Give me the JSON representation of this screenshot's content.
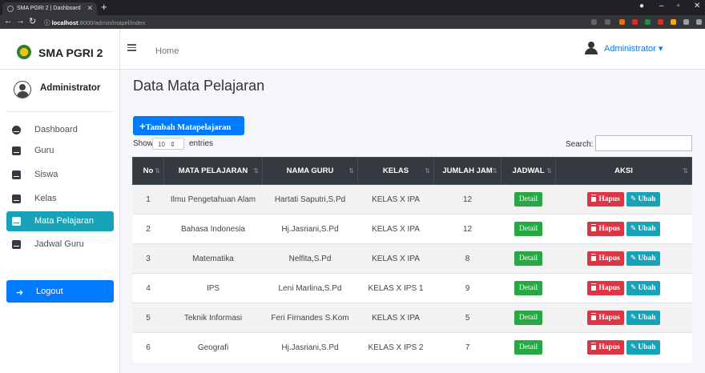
{
  "browser": {
    "tab_title": "SMA PGRI 2 | Dashboard",
    "url_host": "localhost",
    "url_rest": ":8000/admin/mapel/index"
  },
  "sidebar": {
    "brand": "SMA PGRI 2",
    "user": "Administrator",
    "items": [
      {
        "label": "Dashboard",
        "icon": "tachometer-icon"
      },
      {
        "label": "Guru",
        "icon": "table-icon"
      },
      {
        "label": "Siswa",
        "icon": "table-icon"
      },
      {
        "label": "Kelas",
        "icon": "table-icon"
      },
      {
        "label": "Mata Pelajaran",
        "icon": "table-icon",
        "active": true
      },
      {
        "label": "Jadwal Guru",
        "icon": "table-icon"
      }
    ],
    "logout": "Logout"
  },
  "header": {
    "home": "Home",
    "user": "Administrator"
  },
  "main": {
    "title": "Data Mata Pelajaran",
    "add_button": "Tambah Matapelajaran",
    "show_label": "Show",
    "show_value": "10",
    "entries_label": "entries",
    "search_label": "Search:"
  },
  "table": {
    "headers": [
      "No",
      "MATA PELAJARAN",
      "NAMA GURU",
      "KELAS",
      "JUMLAH JAM",
      "JADWAL",
      "AKSI"
    ],
    "detail_label": "Detail",
    "hapus_label": "Hapus",
    "ubah_label": "Ubah",
    "rows": [
      [
        "1",
        "Ilmu Pengetahuan Alam",
        "Hartati Saputri,S.Pd",
        "KELAS X IPA",
        "12"
      ],
      [
        "2",
        "Bahasa Indonesia",
        "Hj.Jasriani,S.Pd",
        "KELAS X IPA",
        "12"
      ],
      [
        "3",
        "Matematika",
        "Nelfita,S.Pd",
        "KELAS X IPA",
        "8"
      ],
      [
        "4",
        "IPS",
        "Leni Marlina,S.Pd",
        "KELAS X IPS 1",
        "9"
      ],
      [
        "5",
        "Teknik Informasi",
        "Feri Firnandes S.Kom",
        "KELAS X IPA",
        "5"
      ],
      [
        "6",
        "Geografi",
        "Hj.Jasriani,S.Pd",
        "KELAS X IPS 2",
        "7"
      ]
    ]
  },
  "colors": {
    "primary": "#007bff",
    "info": "#17a2b8",
    "success": "#28a745",
    "danger": "#dc3545",
    "table_header": "#343a40"
  }
}
